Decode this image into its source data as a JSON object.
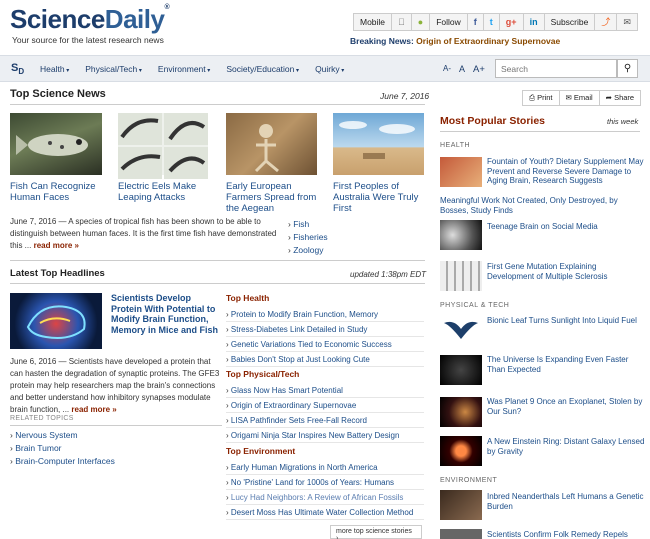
{
  "header": {
    "logo_science": "Science",
    "logo_daily": "Daily",
    "logo_reg": "®",
    "tagline": "Your source for the latest research news",
    "topbar": [
      "Mobile",
      "",
      "",
      "Follow",
      "f",
      "t",
      "g+",
      "in",
      "Subscribe",
      "",
      ""
    ],
    "breaking_label": "Breaking News:",
    "breaking_text": "Origin of Extraordinary Supernovae"
  },
  "nav": {
    "logo": "S",
    "logo_sub": "D",
    "menu": [
      "Health",
      "Physical/Tech",
      "Environment",
      "Society/Education",
      "Quirky"
    ],
    "font_sizes": [
      "A-",
      "A",
      "A+"
    ],
    "search_placeholder": "Search"
  },
  "top_news": {
    "title": "Top Science News",
    "date": "June 7, 2016",
    "stories": [
      "Fish Can Recognize Human Faces",
      "Electric Eels Make Leaping Attacks",
      "Early European Farmers Spread from the Aegean",
      "First Peoples of Australia Were Truly First"
    ],
    "summary_date": "June 7, 2016",
    "summary": " — A species of tropical fish has been shown to be able to distinguish between human faces. It is the first time fish have demonstrated this ...",
    "read_more": "read more »",
    "topics": [
      "Fish",
      "Fisheries",
      "Zoology"
    ]
  },
  "headlines": {
    "title": "Latest Top Headlines",
    "updated": "updated 1:38pm EDT",
    "lead_title": "Scientists Develop Protein With Potential to Modify Brain Function, Memory in Mice and Fish",
    "lead_date": "June 6, 2016",
    "lead_summary": " — Scientists have developed a protein that can hasten the degradation of synaptic proteins. The GFE3 protein may help researchers map the brain's connections and better understand how inhibitory synapses modulate brain function, ...",
    "read_more": "read more »",
    "related_label": "RELATED TOPICS",
    "related": [
      "Nervous System",
      "Brain Tumor",
      "Brain-Computer Interfaces"
    ],
    "sections": [
      {
        "head": "Top Health",
        "items": [
          "Protein to Modify Brain Function, Memory",
          "Stress-Diabetes Link Detailed in Study",
          "Genetic Variations Tied to Economic Success",
          "Babies Don't Stop at Just Looking Cute"
        ]
      },
      {
        "head": "Top Physical/Tech",
        "items": [
          "Glass Now Has Smart Potential",
          "Origin of Extraordinary Supernovae",
          "LISA Pathfinder Sets Free-Fall Record",
          "Origami Ninja Star Inspires New Battery Design"
        ]
      },
      {
        "head": "Top Environment",
        "items": [
          "Early Human Migrations in North America",
          "No 'Pristine' Land for 1000s of Years: Humans",
          "Lucy Had Neighbors: A Review of African Fossils",
          "Desert Moss Has Ultimate Water Collection Method"
        ]
      }
    ],
    "more": "more top science stories"
  },
  "sidebar": {
    "actions": [
      "Print",
      "Email",
      "Share"
    ],
    "title": "Most Popular Stories",
    "period": "this week",
    "categories": [
      "HEALTH",
      "PHYSICAL & TECH",
      "ENVIRONMENT"
    ],
    "health": [
      "Fountain of Youth? Dietary Supplement May Prevent and Reverse Severe Damage to Aging Brain, Research Suggests",
      "Meaningful Work Not Created, Only Destroyed, by Bosses, Study Finds",
      "Teenage Brain on Social Media",
      "First Gene Mutation Explaining Development of Multiple Sclerosis"
    ],
    "physical": [
      "Bionic Leaf Turns Sunlight Into Liquid Fuel",
      "The Universe Is Expanding Even Faster Than Expected",
      "Was Planet 9 Once an Exoplanet, Stolen by Our Sun?",
      "A New Einstein Ring: Distant Galaxy Lensed by Gravity"
    ],
    "environment": [
      "Inbred Neanderthals Left Humans a Genetic Burden",
      "Scientists Confirm Folk Remedy Repels"
    ]
  }
}
